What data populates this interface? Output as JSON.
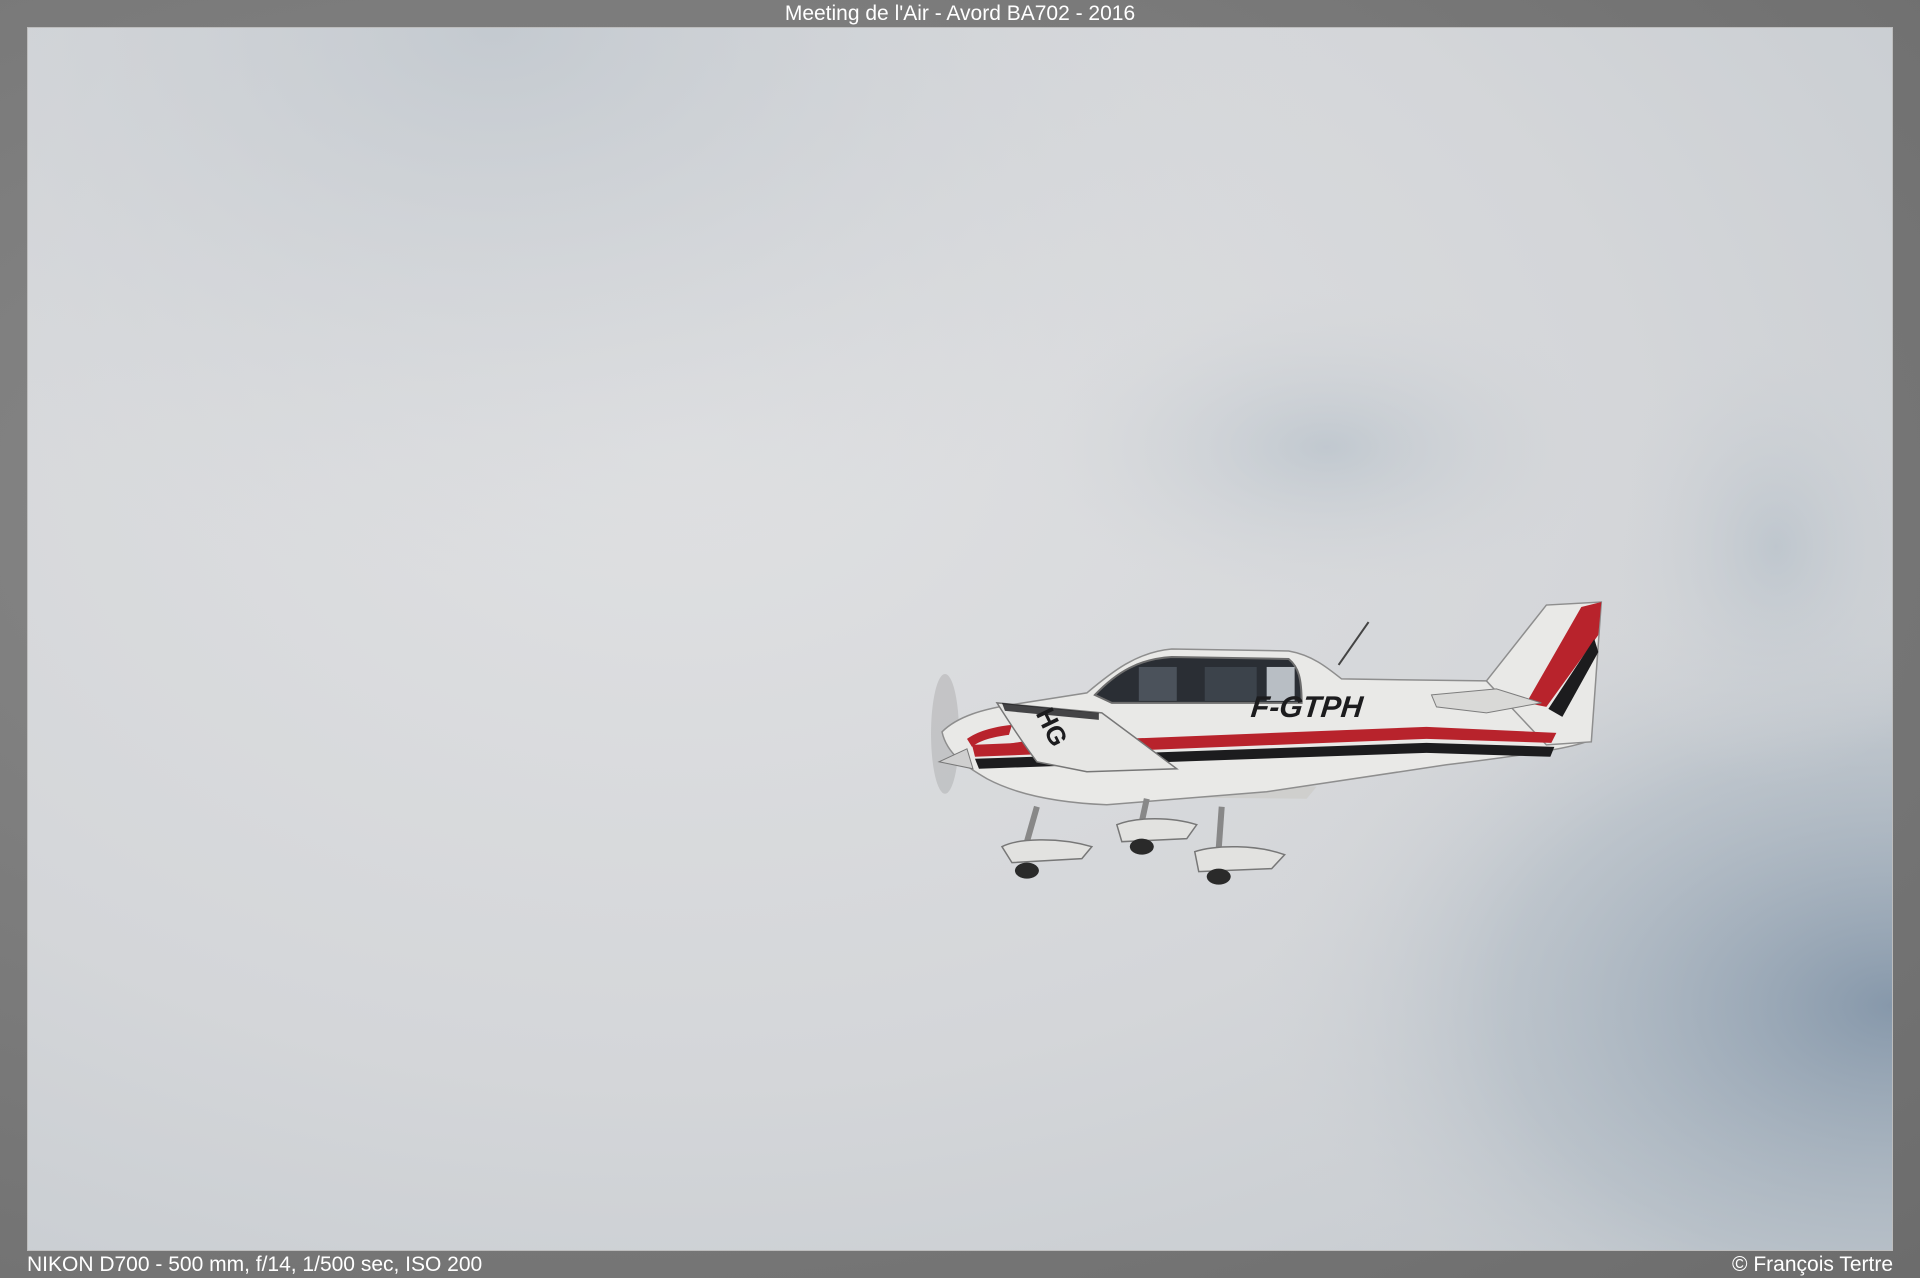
{
  "header": {
    "title": "Meeting de l'Air - Avord BA702 - 2016"
  },
  "photo": {
    "registration": "F-GTPH",
    "underwing_marking": "HG"
  },
  "footer": {
    "exif": "NIKON D700 - 500 mm, f/14, 1/500 sec, ISO 200",
    "copyright": "© François Tertre"
  },
  "colors": {
    "sky": "#d6d8db",
    "cloud_shadow": "#9aa8b4",
    "aircraft_body": "#e8e8e6",
    "stripe_red": "#b8232c",
    "stripe_black": "#1c1c1e"
  }
}
